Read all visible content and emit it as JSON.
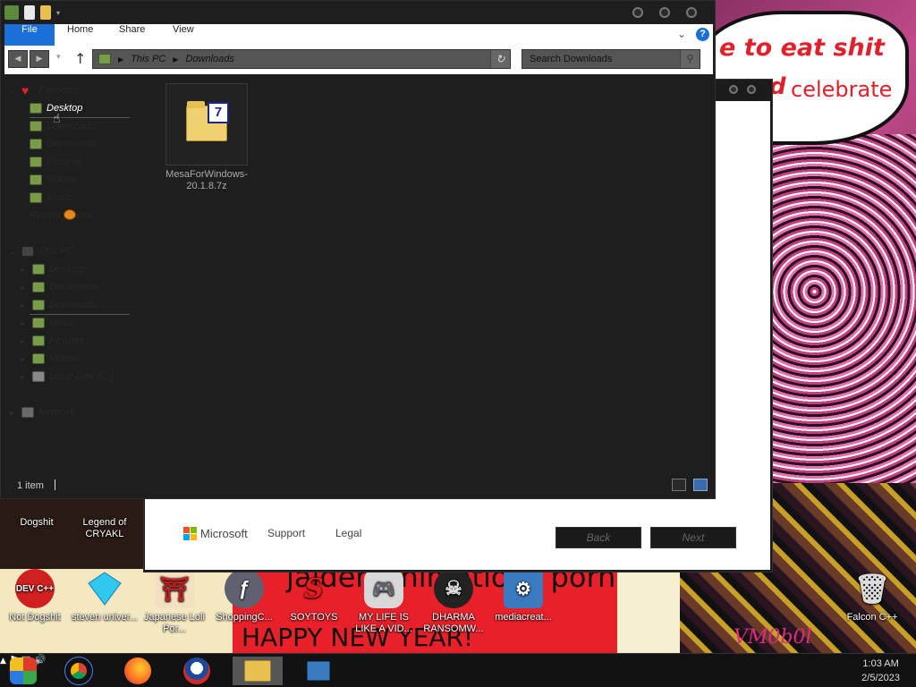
{
  "wallpaper": {
    "speech_line1": "e to eat shit",
    "speech_line2": "celebrate",
    "speech_line3": "and",
    "band_text_top": "jaiden animations porn",
    "band_text_bottom": "HAPPY NEW YEAR!",
    "tag": "VM0b0l"
  },
  "installer": {
    "ms_label": "Microsoft",
    "support_label": "Support",
    "legal_label": "Legal",
    "back_label": "Back",
    "next_label": "Next"
  },
  "explorer": {
    "ribbon": {
      "file": "File",
      "home": "Home",
      "share": "Share",
      "view": "View"
    },
    "address": {
      "segments": [
        "This PC",
        "Downloads"
      ]
    },
    "search": {
      "placeholder": "Search Downloads"
    },
    "nav": {
      "favorites": "Favorites",
      "fav_items": [
        "Desktop",
        "Downloads",
        "Documents",
        "Pictures",
        "Videos",
        "Music",
        "Recent places"
      ],
      "this_pc": "This PC",
      "pc_items": [
        "Desktop",
        "Documents",
        "Downloads",
        "Music",
        "Pictures",
        "Videos",
        "Local Disk (C:)"
      ],
      "network": "Network"
    },
    "files": [
      {
        "name": "MesaForWindows-20.1.8.7z",
        "badge": "7"
      }
    ],
    "status": {
      "count": "1 item"
    }
  },
  "desktop_icons": [
    {
      "label": "Dogshit"
    },
    {
      "label": "Legend of CRYAKL"
    },
    {
      "label": "Not Dogshit",
      "glyph": "DEV C++"
    },
    {
      "label": "steven univer..."
    },
    {
      "label": "Japanese Loli Por..."
    },
    {
      "label": "ShoppingC..."
    },
    {
      "label": "SOYTOYS"
    },
    {
      "label": "MY LIFE IS LIKE A VID..."
    },
    {
      "label": "DHARMA RANSOMW..."
    },
    {
      "label": "mediacreat..."
    },
    {
      "label": "Falcon C++"
    }
  ],
  "taskbar": {
    "items": [
      "start",
      "chrome",
      "firefox",
      "obama",
      "explorer",
      "installer"
    ],
    "time": "1:03 AM",
    "date": "2/5/2023"
  },
  "colors": {
    "accent": "#1a6fd8",
    "wall_red": "#e8202a"
  }
}
